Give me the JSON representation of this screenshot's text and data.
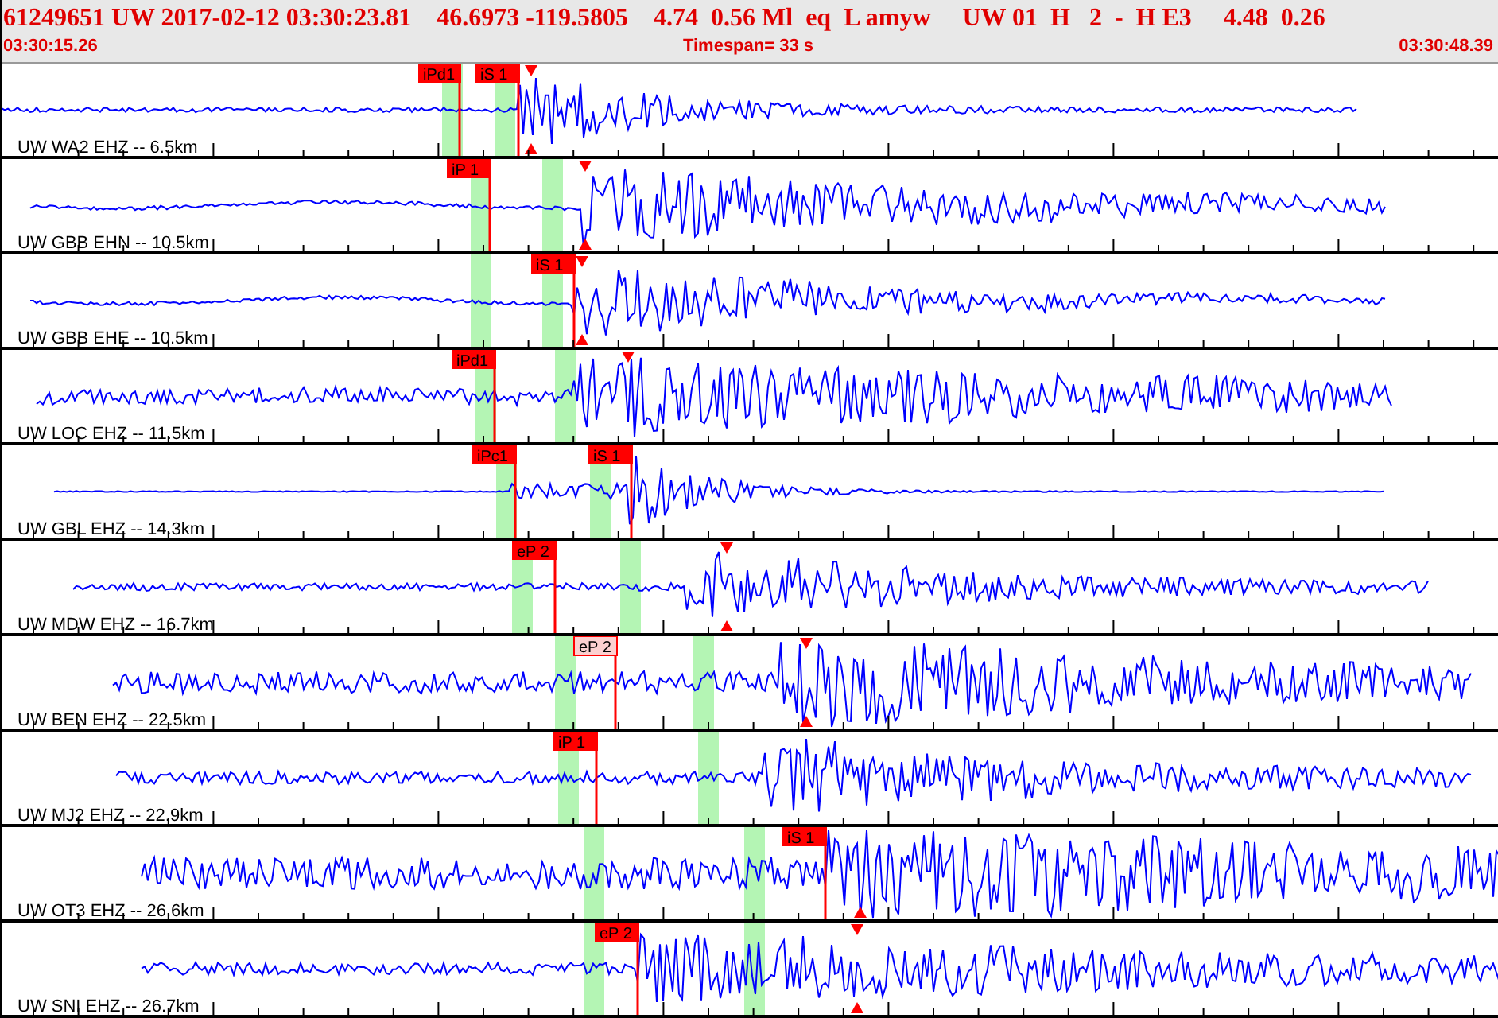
{
  "header": {
    "event_line": "61249651 UW 2017-02-12 03:30:23.81    46.6973 -119.5805    4.74  0.56 Ml  eq  L amyw     UW 01  H   2  -  H E3     4.48  0.26",
    "start_time": "03:30:15.26",
    "timespan": "Timespan=  33 s",
    "end_time": "03:30:48.39"
  },
  "traces": [
    {
      "label": "UW WA2 EHZ -- 6.5km",
      "picks": [
        {
          "label": "iPd1",
          "faded": false
        },
        {
          "label": "iS 1",
          "faded": false
        }
      ]
    },
    {
      "label": "UW GBB EHN -- 10.5km",
      "picks": [
        {
          "label": "iP 1",
          "faded": false
        }
      ]
    },
    {
      "label": "UW GBB EHE -- 10.5km",
      "picks": [
        {
          "label": "iS 1",
          "faded": false
        }
      ]
    },
    {
      "label": "UW LOC EHZ -- 11.5km",
      "picks": [
        {
          "label": "iPd1",
          "faded": false
        }
      ]
    },
    {
      "label": "UW GBL EHZ -- 14.3km",
      "picks": [
        {
          "label": "iPc1",
          "faded": false
        },
        {
          "label": "iS 1",
          "faded": false
        }
      ]
    },
    {
      "label": "UW MDW EHZ -- 16.7km",
      "picks": [
        {
          "label": "eP 2",
          "faded": false
        }
      ]
    },
    {
      "label": "UW BEN EHZ -- 22.5km",
      "picks": [
        {
          "label": "eP 2",
          "faded": true
        }
      ]
    },
    {
      "label": "UW MJ2 EHZ -- 22.9km",
      "picks": [
        {
          "label": "iP 1",
          "faded": false
        }
      ]
    },
    {
      "label": "UW OT3 EHZ -- 26.6km",
      "picks": [
        {
          "label": "iS 1",
          "faded": false
        }
      ]
    },
    {
      "label": "UW SNI EHZ -- 26.7km",
      "picks": [
        {
          "label": "eP 2",
          "faded": false
        }
      ]
    }
  ]
}
